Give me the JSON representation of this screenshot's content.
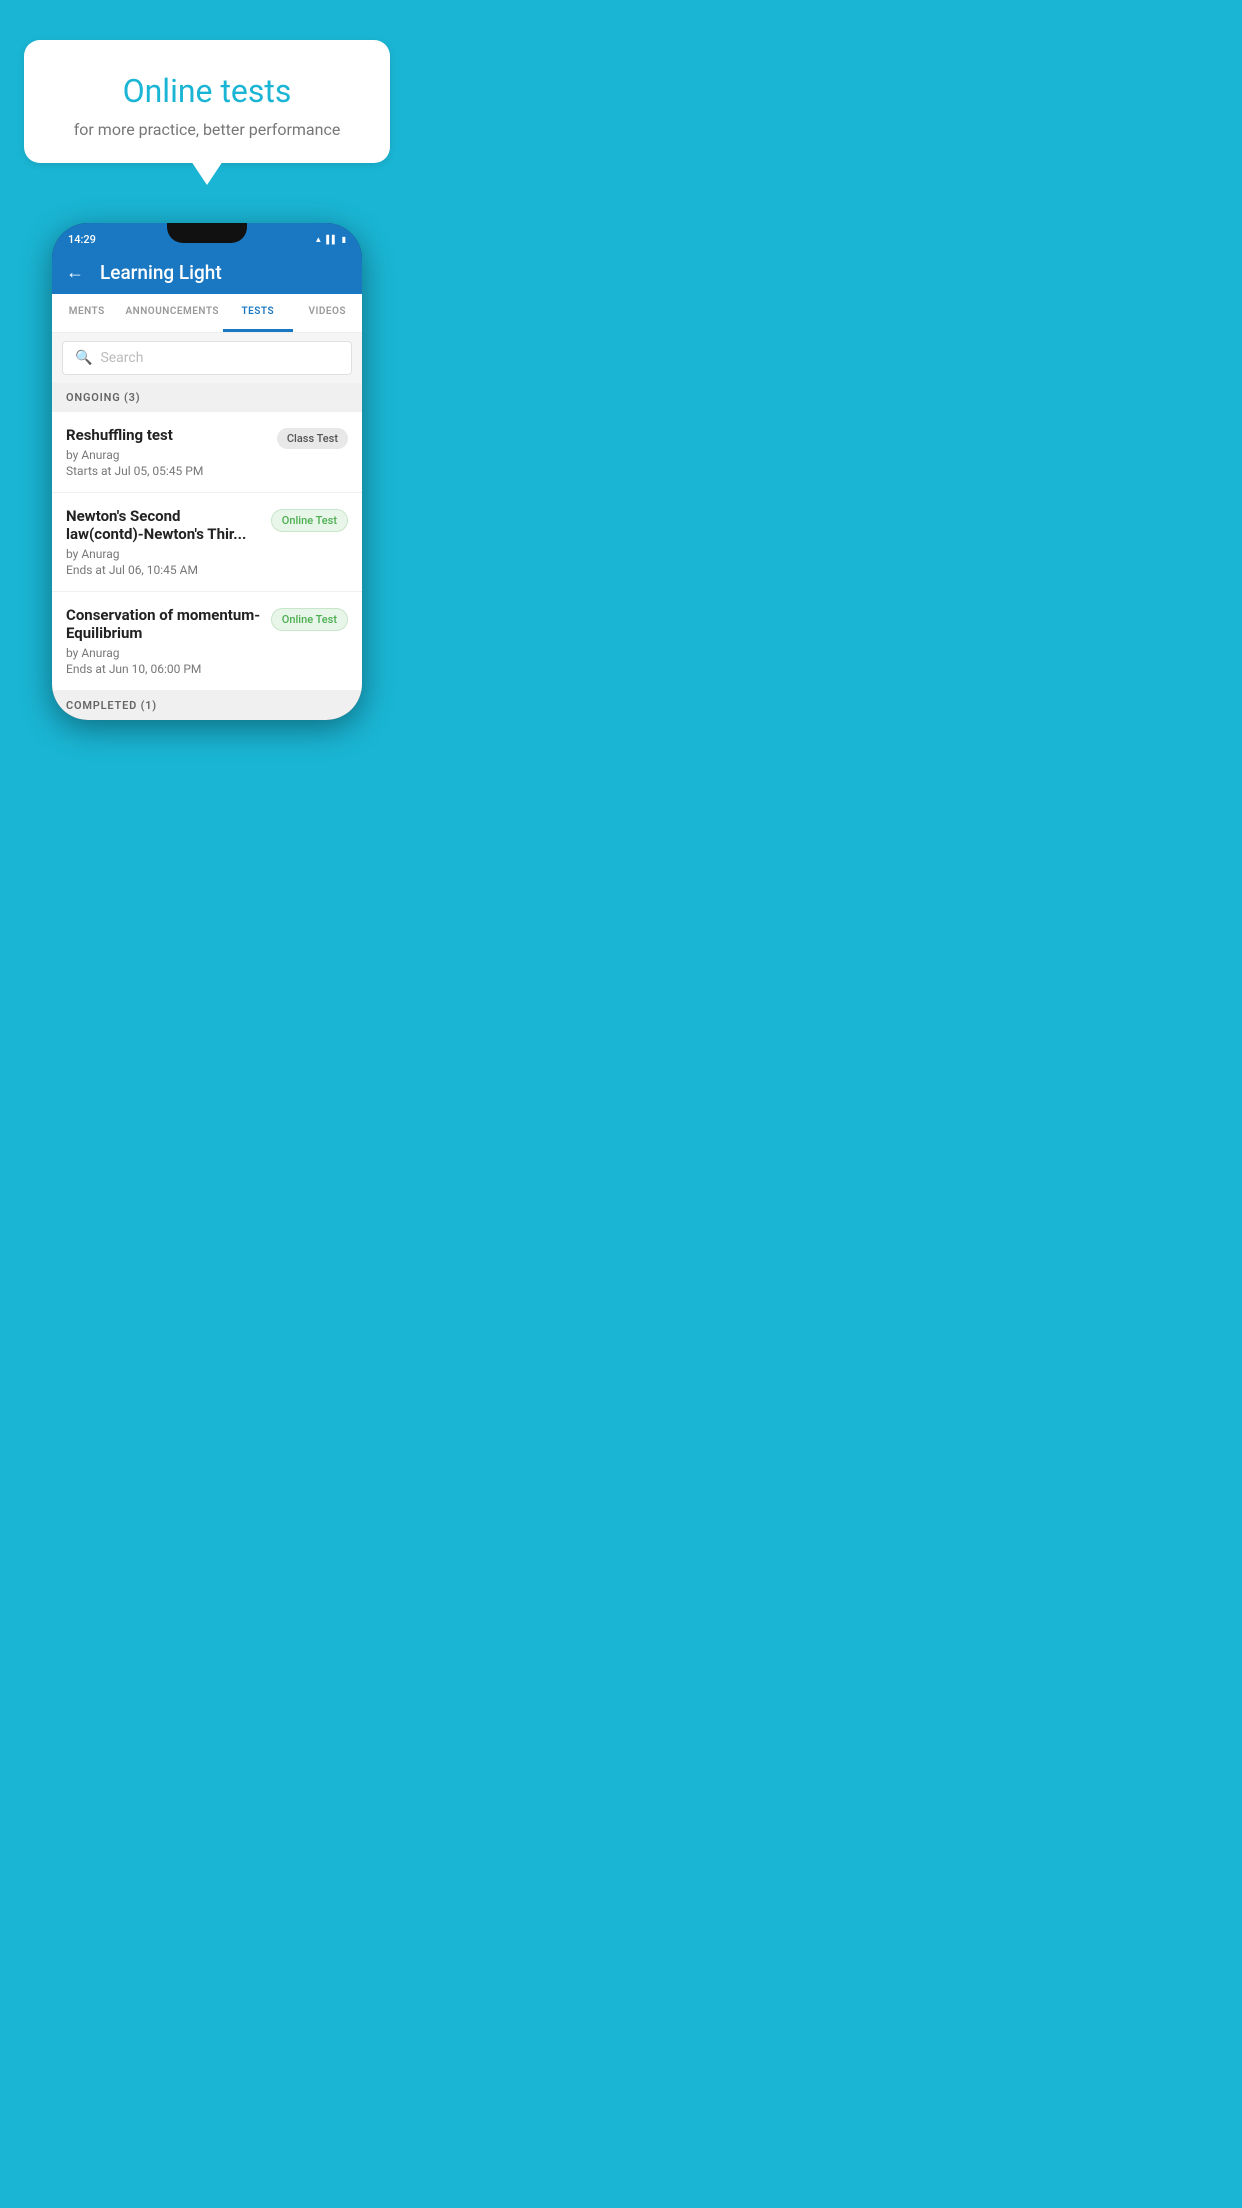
{
  "background_color": "#1ab5d4",
  "bubble": {
    "title": "Online tests",
    "subtitle": "for more practice, better performance"
  },
  "phone": {
    "status_bar": {
      "time": "14:29",
      "icons": [
        "wifi",
        "signal",
        "battery"
      ]
    },
    "app_bar": {
      "title": "Learning Light",
      "back_label": "←"
    },
    "tabs": [
      {
        "label": "MENTS",
        "active": false
      },
      {
        "label": "ANNOUNCEMENTS",
        "active": false
      },
      {
        "label": "TESTS",
        "active": true
      },
      {
        "label": "VIDEOS",
        "active": false
      }
    ],
    "search": {
      "placeholder": "Search",
      "icon": "🔍"
    },
    "ongoing_section": {
      "label": "ONGOING (3)",
      "items": [
        {
          "name": "Reshuffling test",
          "by": "by Anurag",
          "date": "Starts at  Jul 05, 05:45 PM",
          "badge": "Class Test",
          "badge_type": "class"
        },
        {
          "name": "Newton's Second law(contd)-Newton's Thir...",
          "by": "by Anurag",
          "date": "Ends at  Jul 06, 10:45 AM",
          "badge": "Online Test",
          "badge_type": "online"
        },
        {
          "name": "Conservation of momentum-Equilibrium",
          "by": "by Anurag",
          "date": "Ends at  Jun 10, 06:00 PM",
          "badge": "Online Test",
          "badge_type": "online"
        }
      ]
    },
    "completed_section": {
      "label": "COMPLETED (1)"
    }
  }
}
